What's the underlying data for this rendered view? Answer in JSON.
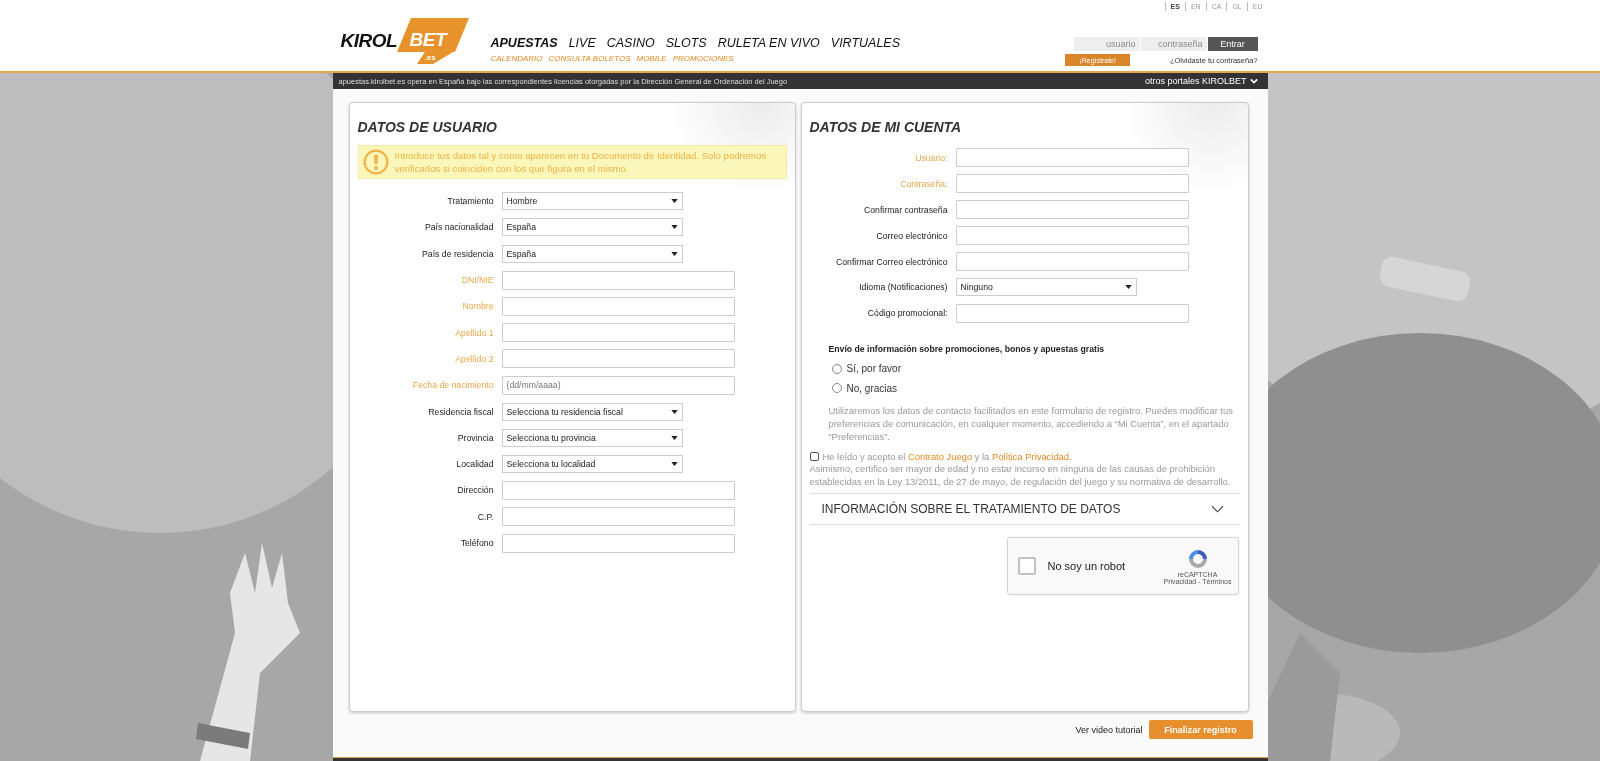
{
  "languages": [
    {
      "label": "ES",
      "selected": true
    },
    {
      "label": "EN",
      "selected": false
    },
    {
      "label": "CA",
      "selected": false
    },
    {
      "label": "GL",
      "selected": false
    },
    {
      "label": "EU",
      "selected": false
    }
  ],
  "logo": {
    "main": "KIROL",
    "accent": "BET",
    "suffix": ".es"
  },
  "nav": {
    "main": [
      {
        "label": "APUESTAS",
        "selected": true
      },
      {
        "label": "LIVE",
        "selected": false
      },
      {
        "label": "CASINO",
        "selected": false
      },
      {
        "label": "SLOTS",
        "selected": false
      },
      {
        "label": "RULETA EN VIVO",
        "selected": false
      },
      {
        "label": "VIRTUALES",
        "selected": false
      }
    ],
    "sub": [
      "CALENDARIO",
      "CONSULTA BOLETOS",
      "MOBILE",
      "PROMOCIONES"
    ]
  },
  "login": {
    "user_placeholder": "usuario",
    "password_placeholder": "contraseña",
    "submit": "Entrar",
    "register": "¡Regístrate!",
    "forgot": "¿Olvidaste tu contraseña?"
  },
  "info_bar": {
    "text": "apuestas.kirolbet.es opera en España bajo las correspondientes licencias otorgadas por la Dirección General de Ordenación del Juego",
    "portals": "otros portales KIROLBET"
  },
  "user_panel": {
    "title": "DATOS DE USUARIO",
    "notice": "Introduce tus datos tal y como aparecen en tu Documento de Identidad. Solo podremos verificarlos si coinciden con los que figura en el mismo.",
    "fields": [
      {
        "label": "Tratamiento",
        "kind": "select",
        "value": "Hombre",
        "required": false
      },
      {
        "label": "País nacionalidad",
        "kind": "select",
        "value": "España",
        "required": false
      },
      {
        "label": "País de residencia",
        "kind": "select",
        "value": "España",
        "required": false
      },
      {
        "label": "DNI/NIE",
        "kind": "input",
        "required": true
      },
      {
        "label": "Nombre",
        "kind": "input",
        "required": true
      },
      {
        "label": "Apellido 1",
        "kind": "input",
        "required": true
      },
      {
        "label": "Apellido 2",
        "kind": "input",
        "required": true
      },
      {
        "label": "Fecha de nacimiento",
        "kind": "input",
        "placeholder": "(dd/mm/aaaa)",
        "required": true
      },
      {
        "label": "Residencia fiscal",
        "kind": "select",
        "value": "Selecciona tu residencia fiscal",
        "required": false
      },
      {
        "label": "Provincia",
        "kind": "select",
        "value": "Selecciona tu provincia",
        "required": false
      },
      {
        "label": "Localidad",
        "kind": "select",
        "value": "Selecciona tu localidad",
        "required": false
      },
      {
        "label": "Dirección",
        "kind": "input",
        "required": false
      },
      {
        "label": "C.P.",
        "kind": "input",
        "required": false
      },
      {
        "label": "Teléfono",
        "kind": "input",
        "required": false
      }
    ]
  },
  "account_panel": {
    "title": "DATOS DE MI CUENTA",
    "fields": [
      {
        "label": "Usuario:",
        "kind": "input",
        "required": true
      },
      {
        "label": "Contraseña:",
        "kind": "input",
        "required": true
      },
      {
        "label": "Confirmar contraseña",
        "kind": "input",
        "required": false
      },
      {
        "label": "Correo electrónico",
        "kind": "input",
        "required": false
      },
      {
        "label": "Confirmar Correo electrónico",
        "kind": "input",
        "required": false
      },
      {
        "label": "Idioma (Notificaciones)",
        "kind": "select",
        "value": "Ninguno",
        "required": false
      },
      {
        "label": "Código promocional:",
        "kind": "input",
        "required": false
      }
    ],
    "promo": {
      "question": "Envío de información sobre promociones, bonos y apuestas gratis",
      "options": [
        {
          "label": "Sí, por favor",
          "selected": false
        },
        {
          "label": "No, gracias",
          "selected": false
        }
      ],
      "note": "Utilizaremos los datos de contacto facilitados en este formulario de registro. Puedes modificar tus preferencias de comunicación, en cualquier momento, accediendo a “Mi Cuenta”, en el apartado “Preferencias”."
    },
    "consent": {
      "checked": false,
      "parts": [
        {
          "kind": "plain",
          "text": "He leído y acepto el "
        },
        {
          "kind": "link",
          "text": "Contrato Juego"
        },
        {
          "kind": "plain",
          "text": " y la "
        },
        {
          "kind": "link",
          "text": "Política Privacidad."
        }
      ],
      "declaration": "Asimismo, certifico ser mayor de edad y no estar incurso en ninguna de las causas de prohibición establecidas en la Ley 13/2011, de 27 de mayo, de regulación del juego y su normativa de desarrollo."
    },
    "accordion": {
      "title": "INFORMACIÓN SOBRE EL TRATAMIENTO DE DATOS",
      "expanded": false
    },
    "captcha": {
      "label": "No soy un robot",
      "checked": false,
      "brand": "reCAPTCHA",
      "links": "Privacidad - Términos"
    }
  },
  "footer": {
    "tutorial": "Ver video tutorial",
    "submit": "Finalizar registro"
  }
}
